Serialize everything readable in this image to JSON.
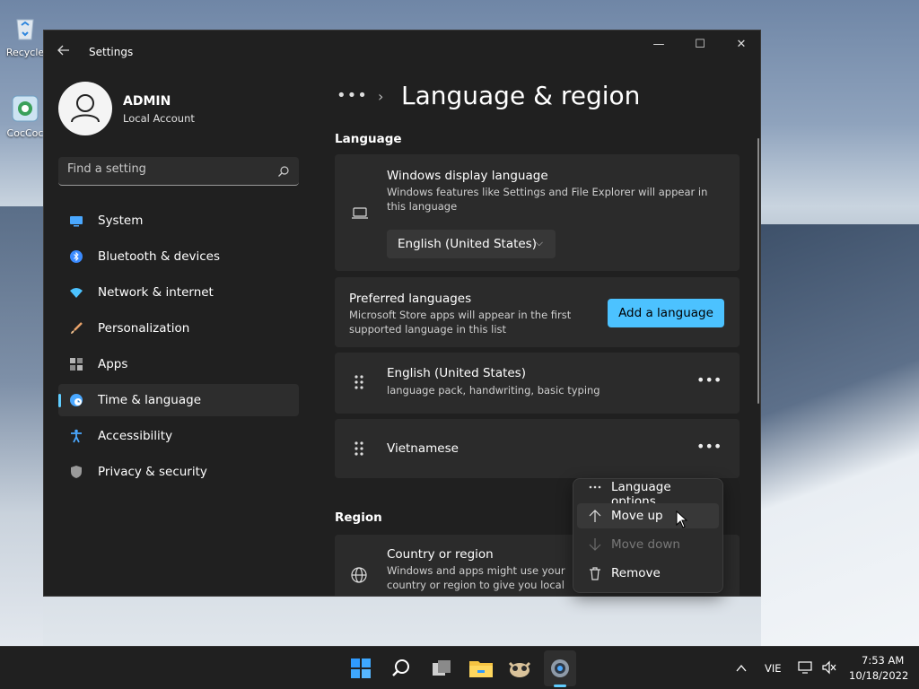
{
  "desktop": {
    "icons": [
      {
        "label": "Recycle"
      },
      {
        "label": "CocCoc"
      }
    ]
  },
  "window": {
    "title": "Settings",
    "controls": {
      "minimize": "—",
      "maximize": "☐",
      "close": "✕"
    }
  },
  "profile": {
    "name": "ADMIN",
    "account_type": "Local Account"
  },
  "search": {
    "placeholder": "Find a setting"
  },
  "nav": {
    "items": [
      {
        "label": "System",
        "icon": "monitor-icon",
        "color": "#4aa8ff"
      },
      {
        "label": "Bluetooth & devices",
        "icon": "bluetooth-icon",
        "color": "#3b8bff"
      },
      {
        "label": "Network & internet",
        "icon": "wifi-icon",
        "color": "#4cc2ff"
      },
      {
        "label": "Personalization",
        "icon": "brush-icon",
        "color": "#e8a26a"
      },
      {
        "label": "Apps",
        "icon": "apps-icon",
        "color": "#b5b5b5"
      },
      {
        "label": "Time & language",
        "icon": "globe-clock-icon",
        "color": "#4aa8ff"
      },
      {
        "label": "Accessibility",
        "icon": "accessibility-icon",
        "color": "#4aa8ff"
      },
      {
        "label": "Privacy & security",
        "icon": "shield-icon",
        "color": "#9a9a9a"
      }
    ],
    "active_index": 5
  },
  "breadcrumb": {
    "overflow": "•••",
    "separator": "›"
  },
  "page": {
    "title": "Language & region"
  },
  "language_section": {
    "heading": "Language",
    "display_language": {
      "title": "Windows display language",
      "subtitle": "Windows features like Settings and File Explorer will appear in this language",
      "selected": "English (United States)"
    },
    "preferred": {
      "title": "Preferred languages",
      "subtitle": "Microsoft Store apps will appear in the first supported language in this list",
      "add_button": "Add a language"
    },
    "languages": [
      {
        "name": "English (United States)",
        "details": "language pack, handwriting, basic typing"
      },
      {
        "name": "Vietnamese",
        "details": ""
      }
    ],
    "more_glyph": "•••"
  },
  "region_section": {
    "heading": "Region",
    "country": {
      "title": "Country or region",
      "subtitle": "Windows and apps might use your country or region to give you local"
    }
  },
  "context_menu": {
    "items": [
      {
        "label": "Language options",
        "icon": "more-icon",
        "enabled": true
      },
      {
        "label": "Move up",
        "icon": "arrow-up-icon",
        "enabled": true,
        "hovered": true
      },
      {
        "label": "Move down",
        "icon": "arrow-down-icon",
        "enabled": false
      },
      {
        "label": "Remove",
        "icon": "trash-icon",
        "enabled": true
      }
    ]
  },
  "taskbar": {
    "apps": [
      "start-icon",
      "search-icon",
      "task-view-icon",
      "file-explorer-icon",
      "coccoc-browser-icon",
      "settings-icon"
    ],
    "active_app": "settings-icon",
    "tray": {
      "input_language": "VIE",
      "time": "7:53 AM",
      "date": "10/18/2022"
    }
  },
  "colors": {
    "accent": "#4cc2ff",
    "window_bg": "#202020",
    "card_bg": "#2b2b2b"
  }
}
